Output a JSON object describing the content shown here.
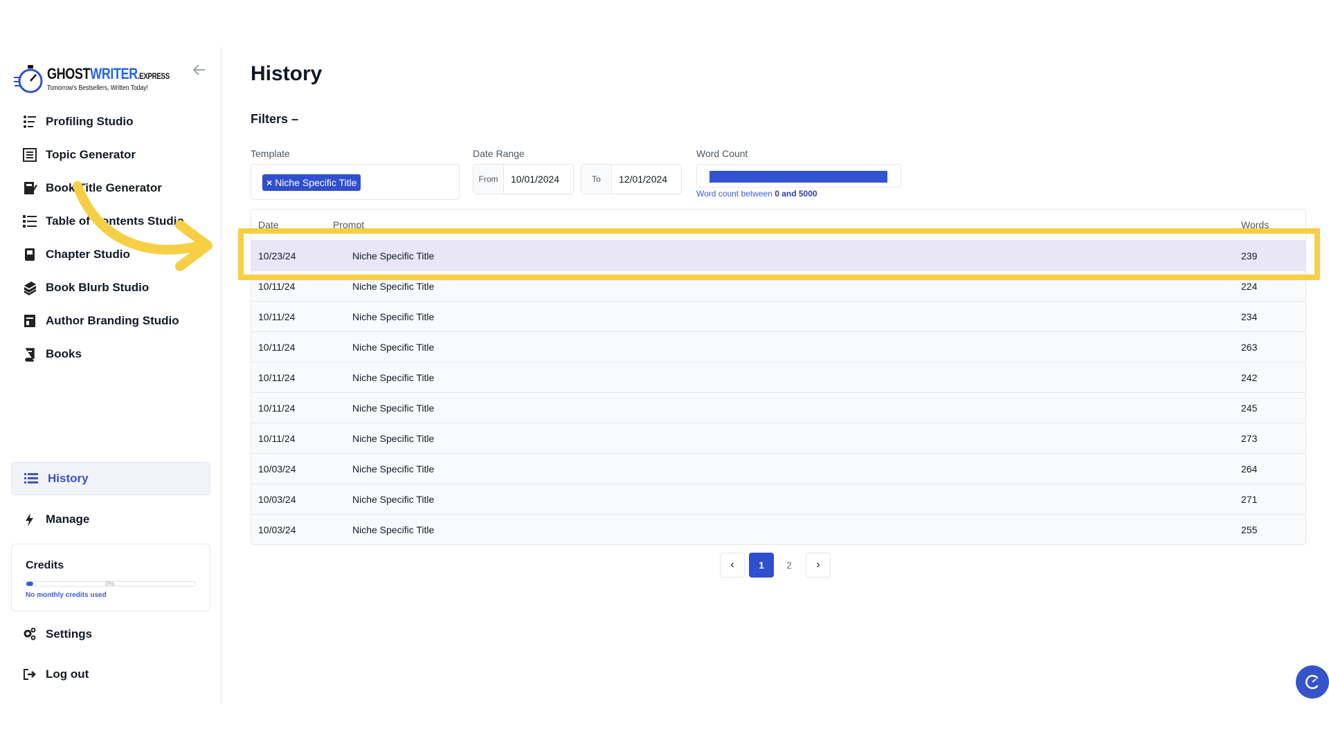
{
  "brand": {
    "name_part1": "GHOST",
    "name_part2": "WRITER",
    "name_suffix": ".EXPRESS",
    "tagline": "Tomorrow's Bestsellers, Written Today!"
  },
  "sidebar": {
    "items": [
      {
        "label": "Profiling Studio",
        "icon": "profiling-icon"
      },
      {
        "label": "Topic Generator",
        "icon": "topic-icon"
      },
      {
        "label": "Book Title Generator",
        "icon": "book-title-icon"
      },
      {
        "label": "Table of Contents Studio",
        "icon": "toc-icon"
      },
      {
        "label": "Chapter Studio",
        "icon": "chapter-icon"
      },
      {
        "label": "Book Blurb Studio",
        "icon": "blurb-icon"
      },
      {
        "label": "Author Branding Studio",
        "icon": "branding-icon"
      },
      {
        "label": "Books",
        "icon": "books-icon"
      }
    ],
    "history_label": "History",
    "manage_label": "Manage",
    "settings_label": "Settings",
    "logout_label": "Log out"
  },
  "credits": {
    "title": "Credits",
    "percent_label": "0%",
    "used_fraction": 0,
    "note": "No monthly credits used"
  },
  "main": {
    "title": "History",
    "filters_title": "Filters –"
  },
  "filters": {
    "template_label": "Template",
    "template_chip_x": "×",
    "template_chip": "Niche Specific Title",
    "date_range_label": "Date Range",
    "from_label": "From",
    "from_value": "10/01/2024",
    "to_label": "To",
    "to_value": "12/01/2024",
    "word_count_label": "Word Count",
    "word_count_note_prefix": "Word count between",
    "word_count_note_range": "0 and 5000"
  },
  "table": {
    "columns": [
      "Date",
      "Prompt",
      "Words"
    ],
    "rows": [
      {
        "date": "10/23/24",
        "prompt": "Niche Specific Title",
        "words": "239"
      },
      {
        "date": "10/11/24",
        "prompt": "Niche Specific Title",
        "words": "224"
      },
      {
        "date": "10/11/24",
        "prompt": "Niche Specific Title",
        "words": "234"
      },
      {
        "date": "10/11/24",
        "prompt": "Niche Specific Title",
        "words": "263"
      },
      {
        "date": "10/11/24",
        "prompt": "Niche Specific Title",
        "words": "242"
      },
      {
        "date": "10/11/24",
        "prompt": "Niche Specific Title",
        "words": "245"
      },
      {
        "date": "10/11/24",
        "prompt": "Niche Specific Title",
        "words": "273"
      },
      {
        "date": "10/03/24",
        "prompt": "Niche Specific Title",
        "words": "264"
      },
      {
        "date": "10/03/24",
        "prompt": "Niche Specific Title",
        "words": "271"
      },
      {
        "date": "10/03/24",
        "prompt": "Niche Specific Title",
        "words": "255"
      }
    ]
  },
  "pagination": {
    "prev": "‹",
    "pages": [
      "1",
      "2"
    ],
    "current": "1",
    "next": "›"
  },
  "colors": {
    "accent": "#2f4fcf",
    "highlight": "#f7cf45",
    "selected_row": "#e8e6f7"
  }
}
